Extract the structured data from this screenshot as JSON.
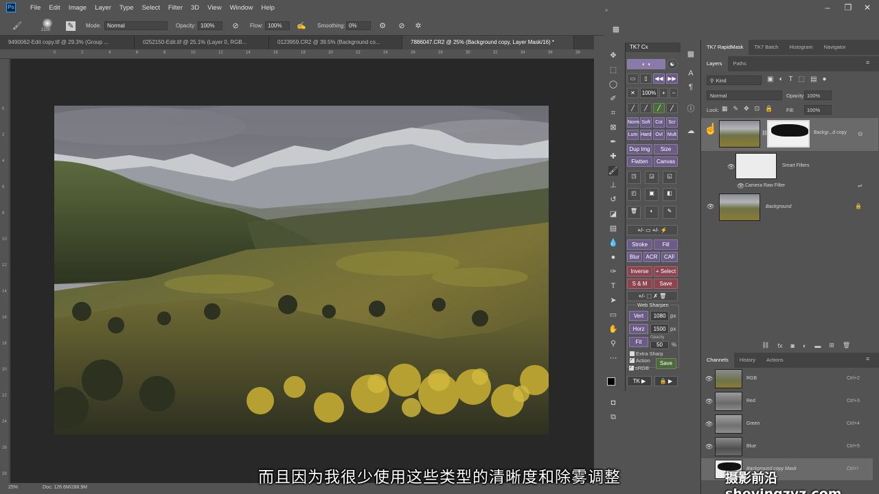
{
  "menu": [
    "File",
    "Edit",
    "Image",
    "Layer",
    "Type",
    "Select",
    "Filter",
    "3D",
    "View",
    "Window",
    "Help"
  ],
  "app_icon": "Ps",
  "options": {
    "brush_size": "2100",
    "mode_label": "Mode:",
    "mode_value": "Normal",
    "opacity_label": "Opacity:",
    "opacity_value": "100%",
    "flow_label": "Flow:",
    "flow_value": "100%",
    "smoothing_label": "Smoothing:",
    "smoothing_value": "0%"
  },
  "tabs": [
    "9490062-Edit copy.tif @ 29.3% (Group ...",
    "0252150-Edit.tif @ 25.1% (Layer 0, RGB...",
    "0123959.CR2 @ 39.5% (Background co...",
    "7886047.CR2 @ 25% (Background copy, Layer Mask/16) *"
  ],
  "ruler_top": [
    "0",
    "2",
    "4",
    "6",
    "8",
    "10",
    "12",
    "14",
    "16",
    "18",
    "20",
    "22",
    "24",
    "26",
    "28",
    "30",
    "32",
    "34",
    "36",
    "38"
  ],
  "ruler_left": [
    "0",
    "2",
    "4",
    "6",
    "8",
    "10",
    "12",
    "14",
    "16",
    "18",
    "20",
    "22",
    "24",
    "26",
    "28"
  ],
  "status": {
    "zoom": "25%",
    "doc": "Doc: 126.6M/288.9M"
  },
  "tk7": {
    "title": "TK7 Cx",
    "row_pct": "100%",
    "modes1": [
      "Norm",
      "Soft",
      "Col",
      "Scr"
    ],
    "modes2": [
      "Lum",
      "Hard",
      "Ovl",
      "Mult"
    ],
    "dup_img": "Dup Img",
    "size": "Size",
    "flatten": "Flatten",
    "canvas": "Canvas",
    "stroke": "Stroke",
    "fill": "Fill",
    "blur": "Blur",
    "acr": "ACR",
    "caf": "CAF",
    "inverse": "Inverse",
    "plus_select": "+ Select",
    "sm": "S & M",
    "save": "Save",
    "web_sharpen": "Web Sharpen",
    "vert": "Vert",
    "vert_val": "1080",
    "horz": "Horz",
    "horz_val": "1500",
    "px": "px",
    "fit": "Fit",
    "opacity_label": "Opacity",
    "opacity_val": "50",
    "pct": "%",
    "extra_sharp": "Extra Sharp",
    "action": "Action",
    "srgb": "sRGB",
    "save2": "Save",
    "tk_btn": "TK ▶",
    "lock_btn": "🔒 ▶"
  },
  "top_panel_tabs": [
    "TK7 RapidMask",
    "TK7 Batch",
    "Histogram",
    "Navigator"
  ],
  "layers_tabs": [
    "Layers",
    "Paths"
  ],
  "layers": {
    "kind": "Kind",
    "blend": "Normal",
    "opacity_label": "Opacity:",
    "opacity_value": "100%",
    "lock_label": "Lock:",
    "fill_label": "Fill:",
    "fill_value": "100%",
    "rows": [
      {
        "name": "Backgr...d copy"
      },
      {
        "name": "Smart Filters"
      },
      {
        "name": "Camera Raw Filter"
      },
      {
        "name": "Background"
      }
    ]
  },
  "channel_tabs": [
    "Channels",
    "History",
    "Actions"
  ],
  "channels": [
    {
      "name": "RGB",
      "key": "Ctrl+2"
    },
    {
      "name": "Red",
      "key": "Ctrl+3"
    },
    {
      "name": "Green",
      "key": "Ctrl+4"
    },
    {
      "name": "Blue",
      "key": "Ctrl+5"
    },
    {
      "name": "Background copy Mask",
      "key": "Ctrl+\\"
    }
  ],
  "subtitle": "而且因为我很少使用这些类型的清晰度和除雾调整",
  "watermark": "摄影前沿 sheyingzyz.com",
  "colors": {
    "accent_purple": "#6b5c86",
    "panel_bg": "#535353",
    "canvas_bg": "#282828"
  }
}
